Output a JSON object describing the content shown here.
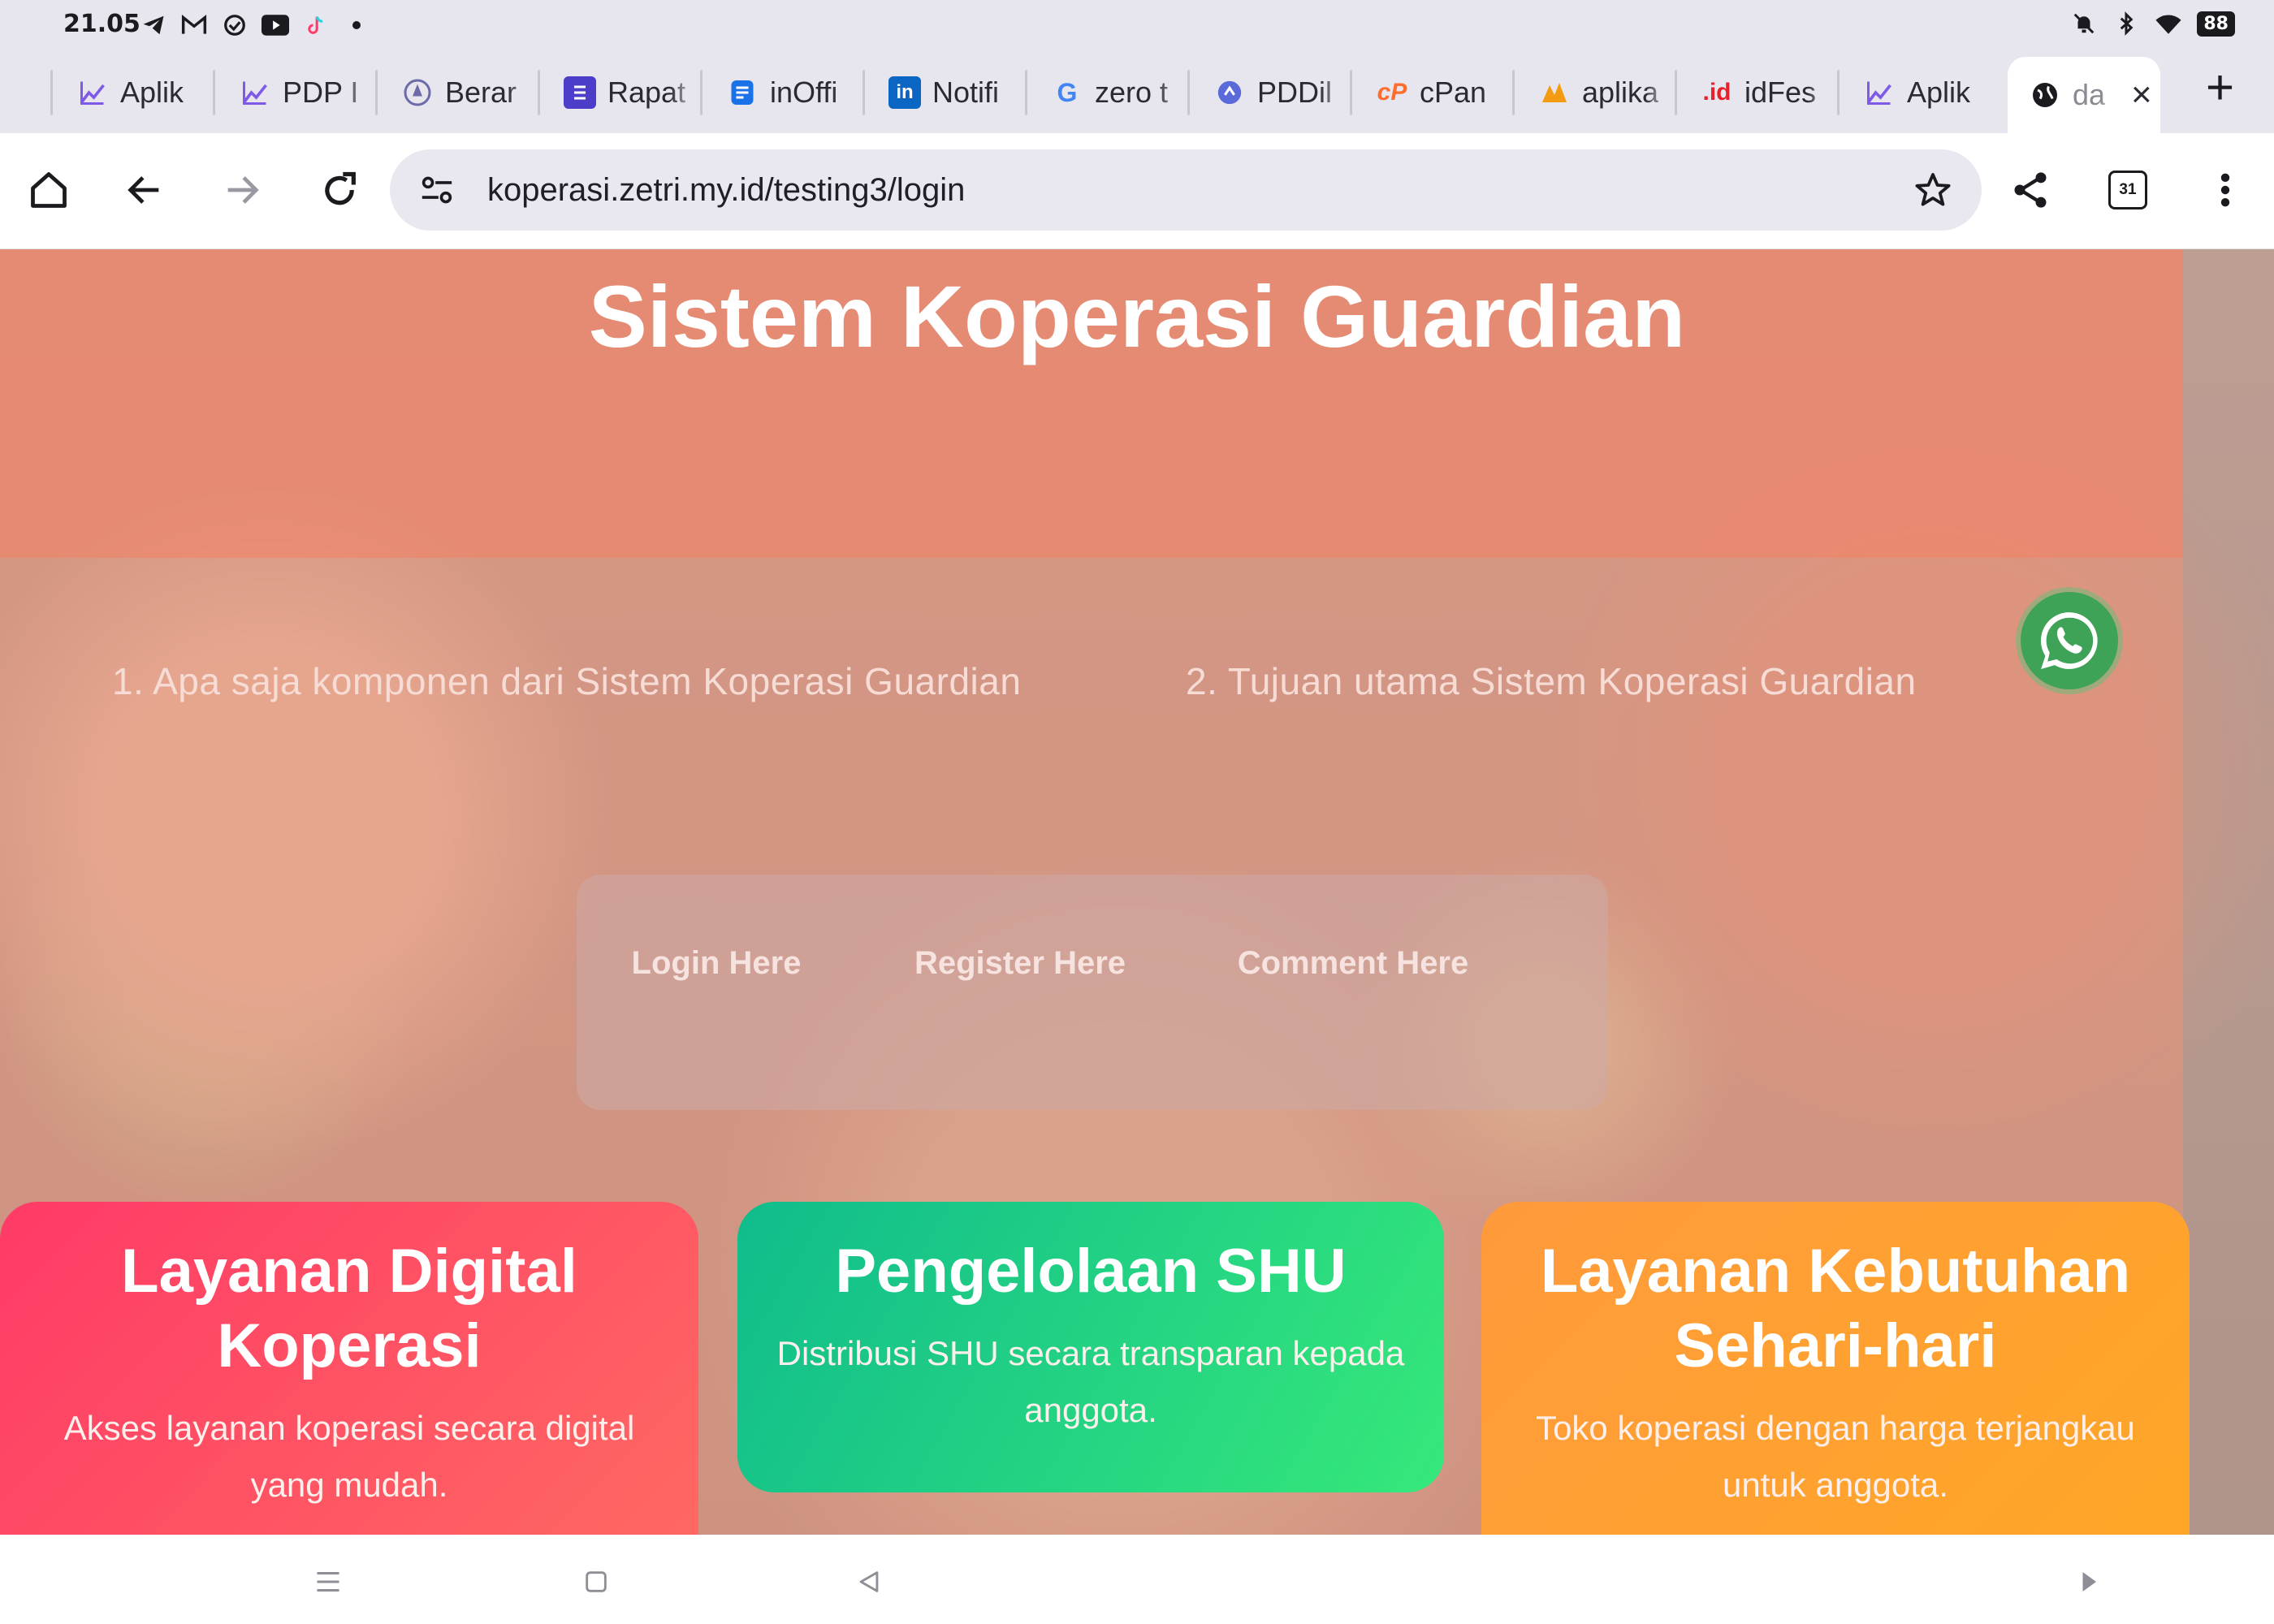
{
  "status_bar": {
    "time": "21.05",
    "battery": "88",
    "left_icons": [
      "telegram-icon",
      "gmail-icon",
      "check-circle-icon",
      "youtube-icon",
      "tiktok-icon",
      "dot-icon"
    ],
    "right_icons": [
      "mute-icon",
      "bluetooth-icon",
      "wifi-icon",
      "battery-icon"
    ]
  },
  "tabs": [
    {
      "label": "Aplik",
      "icon": "chart-favicon-icon",
      "color": "#7e5ae6"
    },
    {
      "label": "PDP I",
      "icon": "chart-favicon-icon",
      "color": "#7e5ae6"
    },
    {
      "label": "Berar",
      "icon": "emblem-favicon-icon",
      "color": "#6b6ba8"
    },
    {
      "label": "Rapat",
      "icon": "list-favicon-icon",
      "color": "#4c3ec8"
    },
    {
      "label": "inOffi",
      "icon": "doc-favicon-icon",
      "color": "#1a72e8"
    },
    {
      "label": "Notifi",
      "icon": "linkedin-favicon-icon",
      "color": "#0a66c2"
    },
    {
      "label": "zero t",
      "icon": "google-favicon-icon",
      "color": "#4285f4"
    },
    {
      "label": "PDDil",
      "icon": "shield-favicon-icon",
      "color": "#5a6ad8"
    },
    {
      "label": "cPan",
      "icon": "cpanel-favicon-icon",
      "color": "#ff6c2c"
    },
    {
      "label": "aplika",
      "icon": "pma-favicon-icon",
      "color": "#f39c12"
    },
    {
      "label": "idFes",
      "icon": "id-favicon-icon",
      "color": "#e8202a"
    },
    {
      "label": "Aplik",
      "icon": "chart-favicon-icon",
      "color": "#7e5ae6"
    }
  ],
  "active_tab": {
    "label": "da",
    "icon": "globe-icon"
  },
  "toolbar": {
    "url": "koperasi.zetri.my.id/testing3/login",
    "tab_count": "31"
  },
  "page": {
    "title": "Sistem Koperasi Guardian",
    "faq": [
      "1. Apa saja komponen dari Sistem Koperasi Guardian",
      "2. Tujuan utama Sistem Koperasi Guardian"
    ],
    "nav": {
      "login": "Login Here",
      "register": "Register Here",
      "comment": "Comment Here"
    },
    "cards": [
      {
        "title": "Layanan Digital Koperasi",
        "desc": "Akses layanan koperasi secara digital yang mudah."
      },
      {
        "title": "Pengelolaan SHU",
        "desc": "Distribusi SHU secara transparan kepada anggota."
      },
      {
        "title": "Layanan Kebutuhan Sehari-hari",
        "desc": "Toko koperasi dengan harga terjangkau untuk anggota."
      }
    ]
  },
  "colors": {
    "card_digital": "#ff3a66",
    "card_shu": "#10bc8c",
    "card_kebutuhan": "#ff9a3c",
    "whatsapp": "#3ea257"
  }
}
